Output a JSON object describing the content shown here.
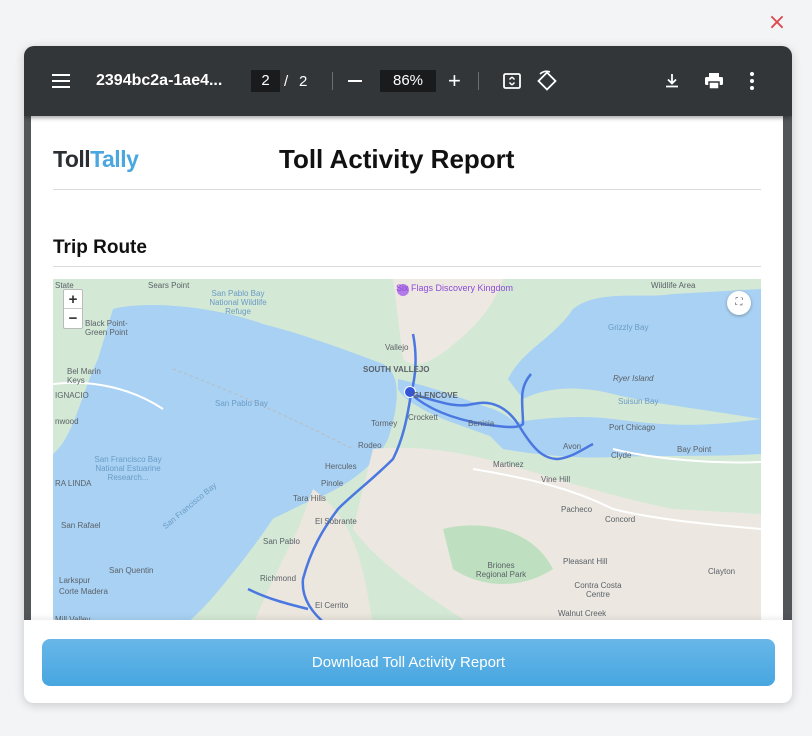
{
  "dialog": {
    "close_label": "×"
  },
  "pdf_toolbar": {
    "title": "2394bc2a-1ae4...",
    "current_page": "2",
    "page_separator": "/",
    "total_pages": "2",
    "zoom": "86%",
    "zoom_in_label": "+",
    "icons": [
      "menu-icon",
      "zoom-out-icon",
      "zoom-in-icon",
      "fit-page-icon",
      "rotate-icon",
      "download-icon",
      "print-icon",
      "more-vertical-icon"
    ]
  },
  "document": {
    "logo_part1": "Toll",
    "logo_part2": "Tally",
    "title": "Toll Activity Report",
    "section_title": "Trip Route"
  },
  "map": {
    "zoom_in": "+",
    "zoom_out": "−",
    "fullscreen_glyph": "⛶",
    "poi": "Six Flags Discovery Kingdom",
    "labels": {
      "state": "State",
      "sears_point": "Sears Point",
      "san_pablo_nwr": "San Pablo Bay National Wildlife Refuge",
      "wildlife_area": "Wildlife Area",
      "black_point": "Black Point-Green Point",
      "bel_marin": "Bel Marin Keys",
      "ignacio": "IGNACIO",
      "vallejo": "Vallejo",
      "south_vallejo": "SOUTH VALLEJO",
      "glencove": "GLENCOVE",
      "san_pablo_bay": "San Pablo Bay",
      "grizzly_bay": "Grizzly Bay",
      "ryer_island": "Ryer Island",
      "suisun_bay": "Suisun Bay",
      "port_chicago": "Port Chicago",
      "tormey": "Tormey",
      "crockett": "Crockett",
      "benicia": "Benicia",
      "rodeo": "Rodeo",
      "hercules": "Hercules",
      "martinez": "Martinez",
      "avon": "Avon",
      "clyde": "Clyde",
      "bay_point": "Bay Point",
      "nwood": "nwood",
      "sf_bay_reserve": "San Francisco Bay National Estuarine Research...",
      "ra_linda": "RA LINDA",
      "pinole": "Pinole",
      "tara_hills": "Tara Hills",
      "vine_hill": "Vine Hill",
      "pacheco": "Pacheco",
      "concord": "Concord",
      "san_rafael": "San Rafael",
      "el_sobrante": "El Sobrante",
      "san_pablo": "San Pablo",
      "san_quentin": "San Quentin",
      "richmond": "Richmond",
      "briones": "Briones Regional Park",
      "pleasant_hill": "Pleasant Hill",
      "clayton": "Clayton",
      "larkspur": "Larkspur",
      "corte_madera": "Corte Madera",
      "contra_costa_centre": "Contra Costa Centre",
      "el_cerrito": "El Cerrito",
      "walnut_creek": "Walnut Creek",
      "mill_valley": "Mill Valley",
      "sf_bay_label": "San Francisco Bay"
    }
  },
  "footer": {
    "download_label": "Download Toll Activity Report"
  }
}
